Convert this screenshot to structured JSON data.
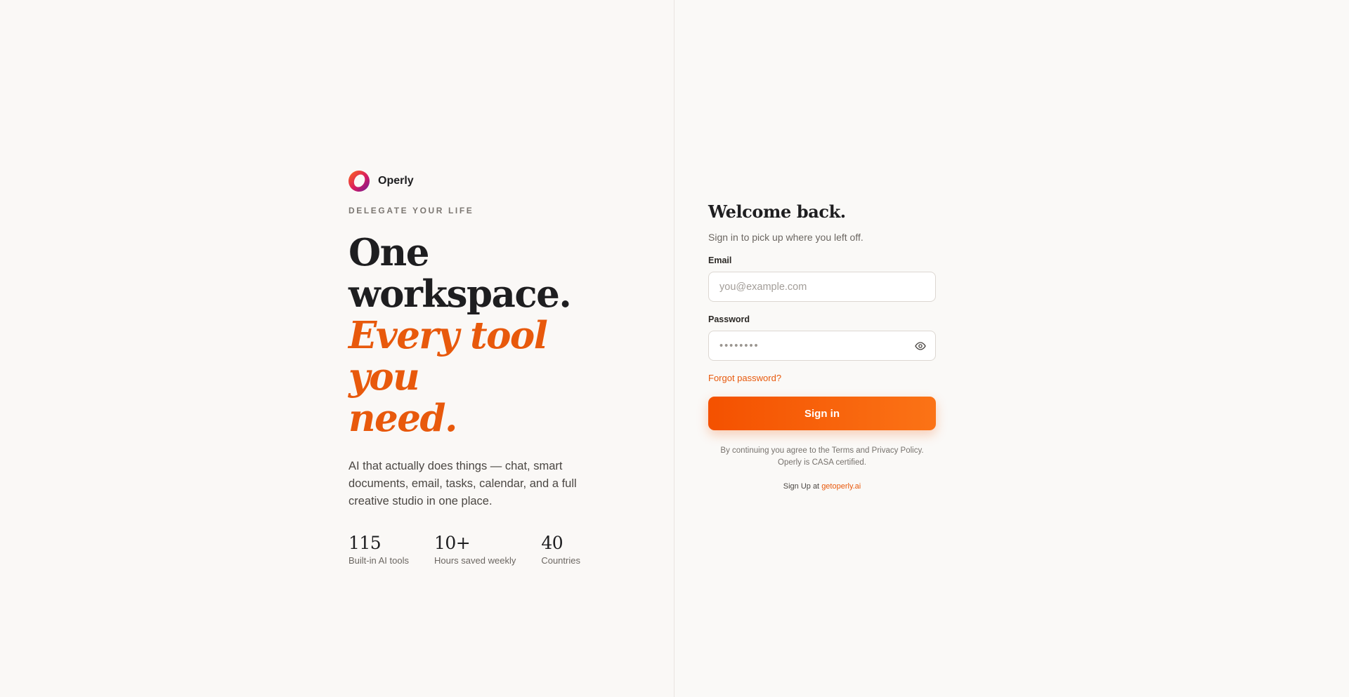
{
  "brand": {
    "name": "Operly",
    "logo_icon": "ring-logo-icon",
    "colors": [
      "#f4511e",
      "#c2185b",
      "#7b1fa2"
    ]
  },
  "hero": {
    "eyebrow": "DELEGATE YOUR LIFE",
    "headline_line1": "One",
    "headline_line2": "workspace.",
    "headline_accent_line1": "Every tool you",
    "headline_accent_line2": "need.",
    "lede": "AI that actually does things — chat, smart documents, email, tasks, calendar, and a full creative studio in one place."
  },
  "stats": [
    {
      "value": "115",
      "label": "Built-in AI tools"
    },
    {
      "value": "10+",
      "label": "Hours saved weekly"
    },
    {
      "value": "40",
      "label": "Countries"
    }
  ],
  "form": {
    "title": "Welcome back.",
    "subtitle": "Sign in to pick up where you left off.",
    "email_label": "Email",
    "email_placeholder": "you@example.com",
    "email_value": "",
    "password_label": "Password",
    "password_placeholder": "••••••••",
    "password_value": "",
    "password_toggle_icon": "eye-icon",
    "forgot_label": "Forgot password?",
    "submit_label": "Sign in",
    "legal_line1": "By continuing you agree to the Terms and Privacy Policy.",
    "legal_line2": "Operly is CASA certified.",
    "signup_prefix": "Sign Up at",
    "signup_link": "getoperly.ai"
  },
  "colors": {
    "accent": "#e8590c",
    "button_start": "#f45100",
    "button_end": "#fb7316",
    "background": "#faf8f6",
    "divider": "#e9e5e1"
  }
}
